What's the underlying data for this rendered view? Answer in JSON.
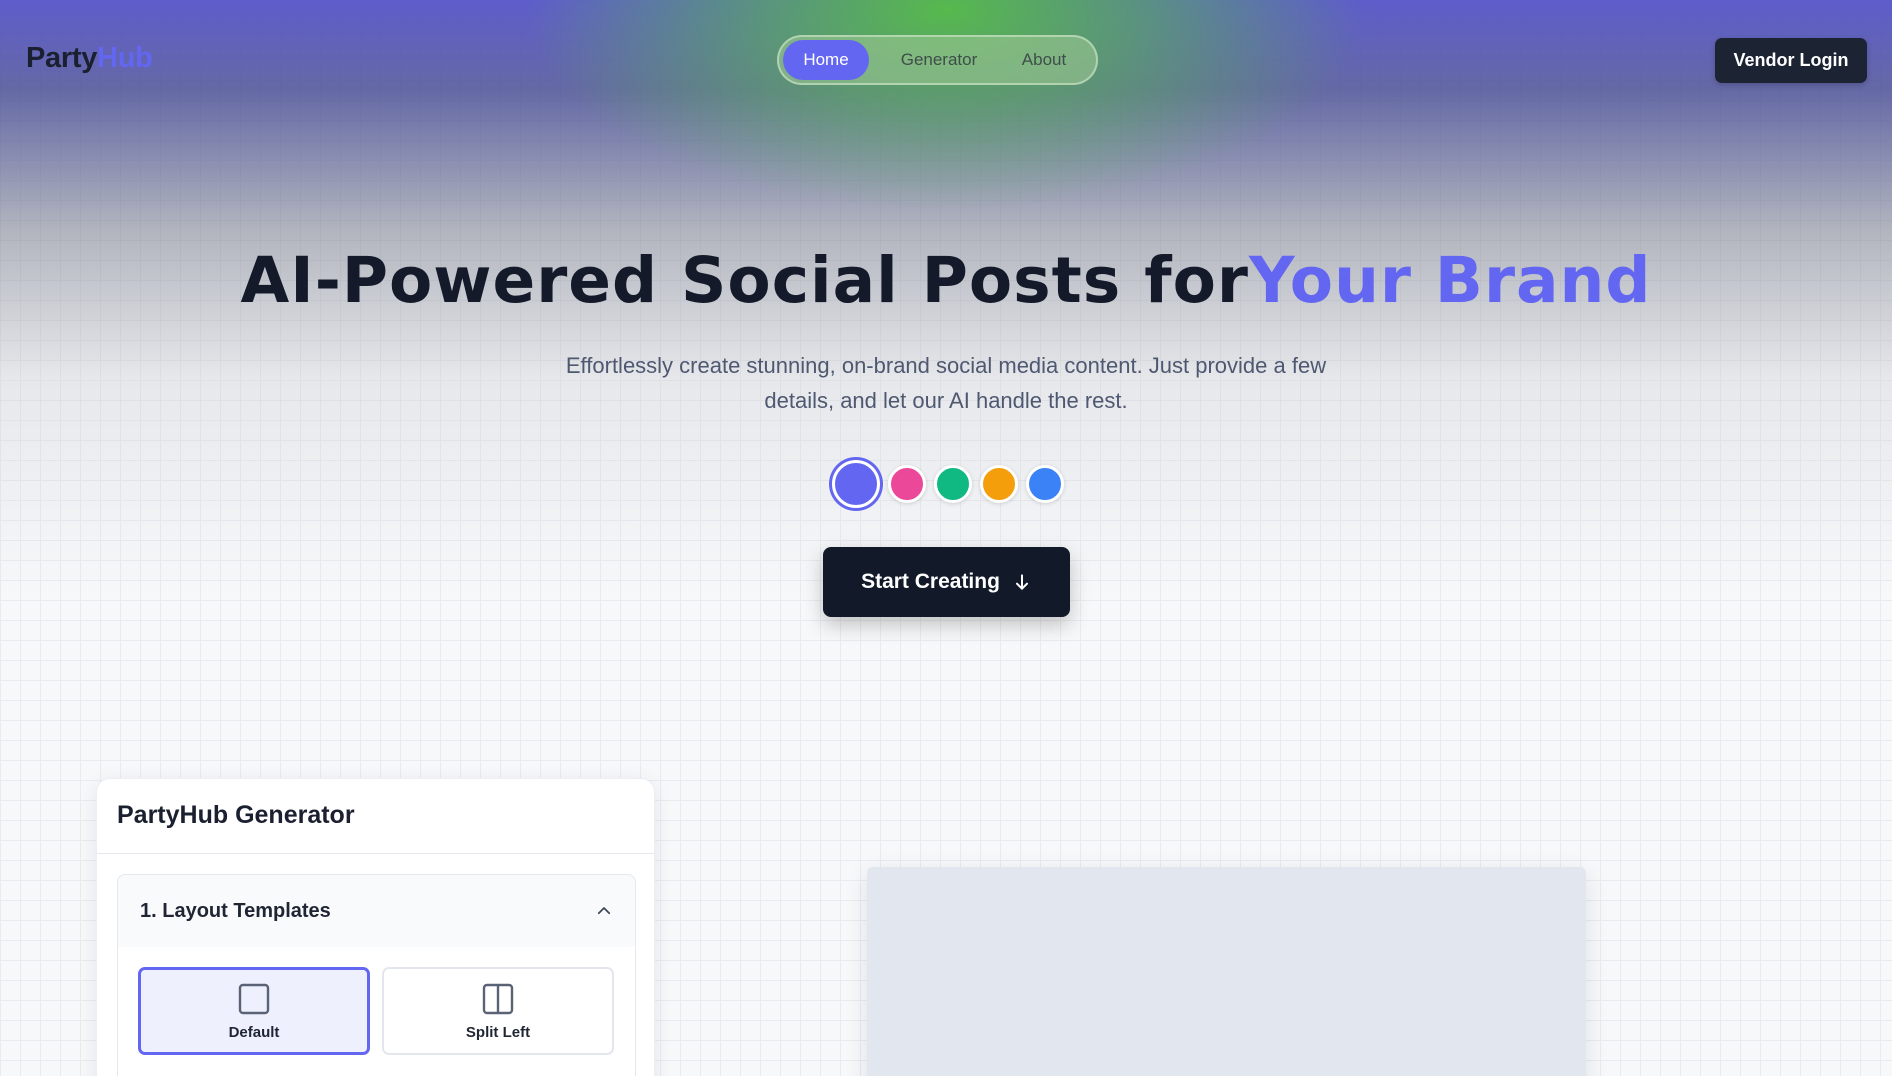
{
  "header": {
    "logo_part1": "Party",
    "logo_part2": "Hub",
    "nav": [
      "Home",
      "Generator",
      "About"
    ],
    "vendor_login": "Vendor Login"
  },
  "hero": {
    "title_main": "AI-Powered Social Posts for",
    "title_accent": "Your Brand",
    "subtitle_line1": "Effortlessly create stunning, on-brand social media content. Just provide a few",
    "subtitle_line2": "details, and let our AI handle the rest.",
    "swatches": [
      {
        "name": "indigo",
        "color": "#6366f1",
        "selected": true
      },
      {
        "name": "pink",
        "color": "#ec4899",
        "selected": false
      },
      {
        "name": "green",
        "color": "#10b981",
        "selected": false
      },
      {
        "name": "amber",
        "color": "#f59e0b",
        "selected": false
      },
      {
        "name": "blue",
        "color": "#3b82f6",
        "selected": false
      }
    ],
    "cta_label": "Start Creating",
    "cta_icon": "arrow-down-icon"
  },
  "generator": {
    "title": "PartyHub Generator",
    "section_title": "1. Layout Templates",
    "section_icon": "chevron-up-icon",
    "templates": [
      {
        "label": "Default",
        "icon": "square-icon",
        "selected": true
      },
      {
        "label": "Split Left",
        "icon": "split-columns-icon",
        "selected": false
      }
    ]
  },
  "colors": {
    "accent": "#6366f1",
    "dark": "#121a2a"
  }
}
